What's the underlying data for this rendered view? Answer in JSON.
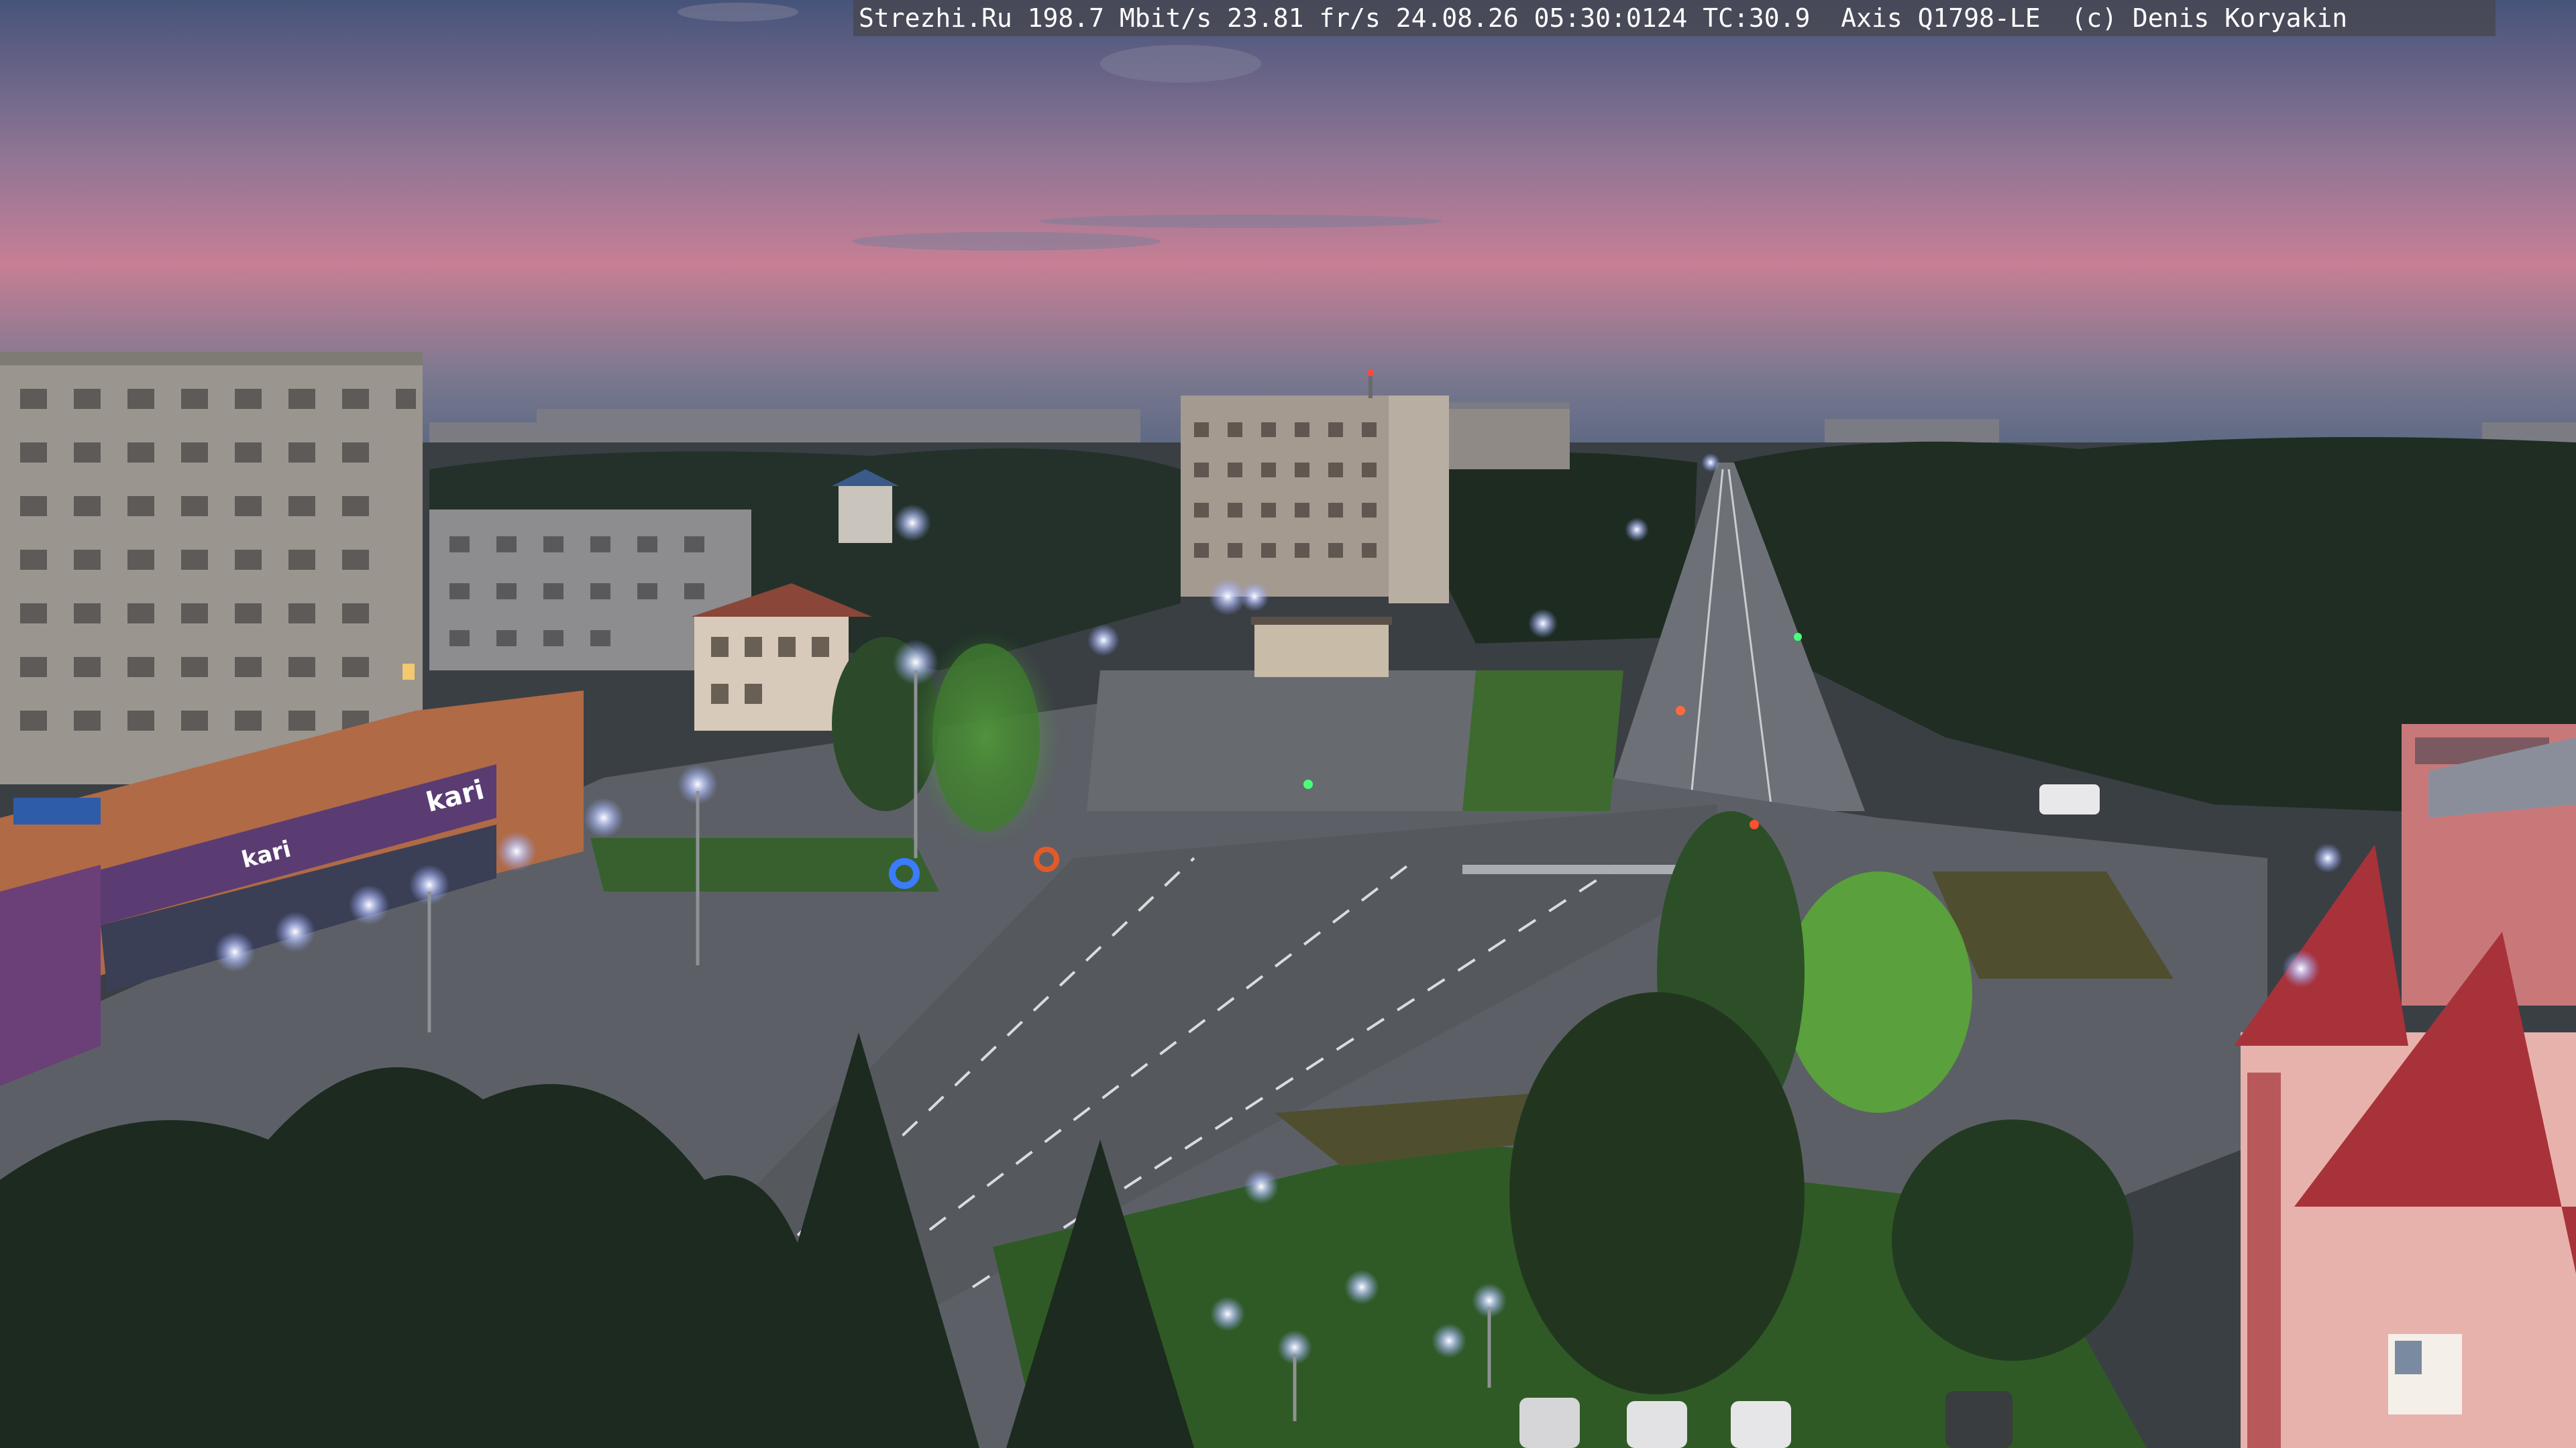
{
  "overlay": {
    "caption": "Strezhi.Ru 198.7 Mbit/s 23.81 fr/s 24.08.26 05:30:0124 TC:30.9  Axis Q1798-LE  (c) Denis Koryakin"
  },
  "signs": {
    "store_left": "kari",
    "store_small": "kari"
  },
  "colors": {
    "sky_top": "#4a5877",
    "sky_pink": "#c77f95",
    "sky_horizon": "#6d7590",
    "foliage_dark": "#1d2a1f",
    "road": "#5a5e63",
    "street_light": "#cfd8ff"
  }
}
